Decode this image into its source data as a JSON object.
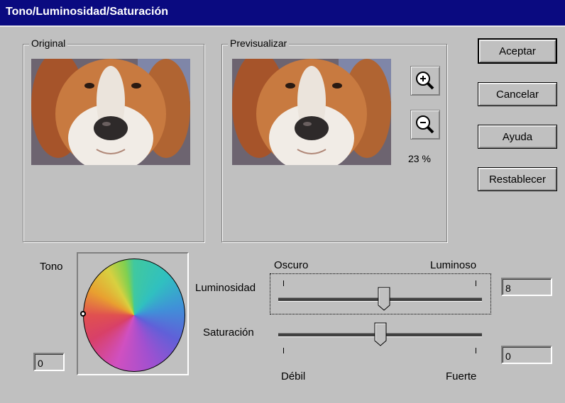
{
  "window": {
    "title": "Tono/Luminosidad/Saturación"
  },
  "original": {
    "label": "Original"
  },
  "preview": {
    "label": "Previsualizar",
    "zoom_text": "23 %"
  },
  "buttons": {
    "accept": "Aceptar",
    "cancel": "Cancelar",
    "help": "Ayuda",
    "reset": "Restablecer"
  },
  "hue": {
    "label": "Tono",
    "value": "0"
  },
  "lightness": {
    "label": "Luminosidad",
    "min_label": "Oscuro",
    "max_label": "Luminoso",
    "value": "8",
    "slider_fraction": 0.52
  },
  "saturation": {
    "label": "Saturación",
    "min_label": "Débil",
    "max_label": "Fuerte",
    "value": "0",
    "slider_fraction": 0.5
  },
  "icons": {
    "zoom_in": "zoom-in-icon",
    "zoom_out": "zoom-out-icon"
  },
  "colors": {
    "titlebar": "#0a0a80",
    "face": "#c0c0c0"
  }
}
